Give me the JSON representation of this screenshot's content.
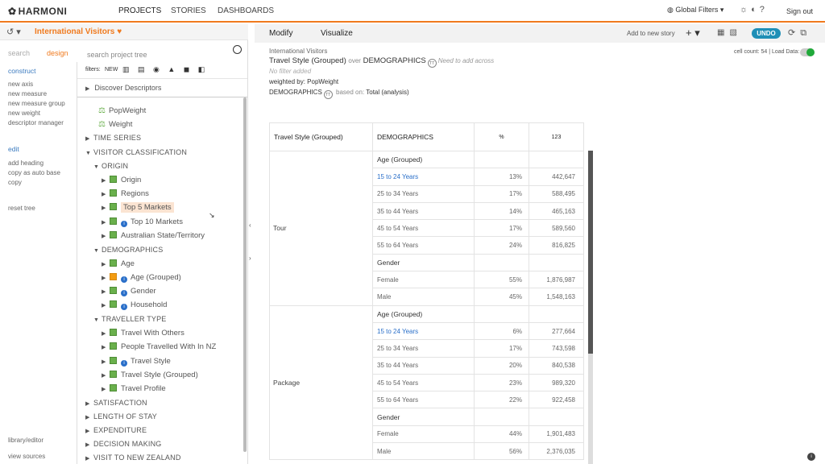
{
  "nav": {
    "logo": "HARMONI",
    "tabs": [
      "PROJECTS",
      "STORIES",
      "DASHBOARDS"
    ],
    "global_filters": "Global Filters",
    "sign_out": "Sign out"
  },
  "project": {
    "name": "International Visitors"
  },
  "left": {
    "tab_search": "search",
    "tab_design": "design",
    "search_placeholder": "search project tree",
    "commands": [
      "construct",
      "new axis",
      "new measure",
      "new measure group",
      "new weight",
      "descriptor manager",
      "edit",
      "add heading",
      "copy as auto base",
      "copy",
      "reset tree"
    ],
    "library_editor": "library/editor",
    "view_sources": "view sources"
  },
  "tree": {
    "filters_label": "filters:",
    "filters_new": "NEW",
    "discover": "Discover Descriptors",
    "nodes": [
      {
        "label": "PopWeight"
      },
      {
        "label": "Weight"
      },
      {
        "label": "TIME SERIES"
      },
      {
        "label": "VISITOR CLASSIFICATION"
      },
      {
        "label": "ORIGIN"
      },
      {
        "label": "Origin"
      },
      {
        "label": "Regions"
      },
      {
        "label": "Top 5 Markets"
      },
      {
        "label": "Top 10 Markets"
      },
      {
        "label": "Australian State/Territory"
      },
      {
        "label": "DEMOGRAPHICS"
      },
      {
        "label": "Age"
      },
      {
        "label": "Age (Grouped)"
      },
      {
        "label": "Gender"
      },
      {
        "label": "Household"
      },
      {
        "label": "TRAVELLER TYPE"
      },
      {
        "label": "Travel With Others"
      },
      {
        "label": "People Travelled With In NZ"
      },
      {
        "label": "Travel Style"
      },
      {
        "label": "Travel Style (Grouped)"
      },
      {
        "label": "Travel Profile"
      },
      {
        "label": "SATISFACTION"
      },
      {
        "label": "LENGTH OF STAY"
      },
      {
        "label": "EXPENDITURE"
      },
      {
        "label": "DECISION MAKING"
      },
      {
        "label": "VISIT TO NEW ZEALAND"
      }
    ]
  },
  "toolbar": {
    "modify": "Modify",
    "visualize": "Visualize",
    "add_story": "Add to new story",
    "undo": "UNDO"
  },
  "report": {
    "project": "International Visitors",
    "title_a": "Travel Style (Grouped)",
    "title_over": "over",
    "title_b": "DEMOGRAPHICS",
    "need_across": "Need to add across",
    "no_filter": "No filter added",
    "weighted_label": "weighted by:",
    "weighted_by": "PopWeight",
    "base_a": "DEMOGRAPHICS",
    "base_label": "based on:",
    "base_b": "Total (analysis)",
    "cell_count": "cell count: 54 | Load Data:"
  },
  "table": {
    "headers": [
      "Travel Style (Grouped)",
      "DEMOGRAPHICS",
      "%",
      "123"
    ],
    "groups": [
      {
        "name": "Tour",
        "sections": [
          {
            "title": "Age (Grouped)",
            "rows": [
              {
                "label": "15 to 24 Years",
                "pct": "13%",
                "count": "442,647"
              },
              {
                "label": "25 to 34 Years",
                "pct": "17%",
                "count": "588,495"
              },
              {
                "label": "35 to 44 Years",
                "pct": "14%",
                "count": "465,163"
              },
              {
                "label": "45 to 54 Years",
                "pct": "17%",
                "count": "589,560"
              },
              {
                "label": "55 to 64 Years",
                "pct": "24%",
                "count": "816,825"
              }
            ]
          },
          {
            "title": "Gender",
            "rows": [
              {
                "label": "Female",
                "pct": "55%",
                "count": "1,876,987"
              },
              {
                "label": "Male",
                "pct": "45%",
                "count": "1,548,163"
              }
            ]
          }
        ]
      },
      {
        "name": "Package",
        "sections": [
          {
            "title": "Age (Grouped)",
            "rows": [
              {
                "label": "15 to 24 Years",
                "pct": "6%",
                "count": "277,664"
              },
              {
                "label": "25 to 34 Years",
                "pct": "17%",
                "count": "743,598"
              },
              {
                "label": "35 to 44 Years",
                "pct": "20%",
                "count": "840,538"
              },
              {
                "label": "45 to 54 Years",
                "pct": "23%",
                "count": "989,320"
              },
              {
                "label": "55 to 64 Years",
                "pct": "22%",
                "count": "922,458"
              }
            ]
          },
          {
            "title": "Gender",
            "rows": [
              {
                "label": "Female",
                "pct": "44%",
                "count": "1,901,483"
              },
              {
                "label": "Male",
                "pct": "56%",
                "count": "2,376,035"
              }
            ]
          }
        ]
      }
    ]
  },
  "colors": {
    "accent": "#f07a1e",
    "undo": "#1f8fb6",
    "tree_cube": "#6ab04c",
    "load_data": "#20a93a"
  }
}
